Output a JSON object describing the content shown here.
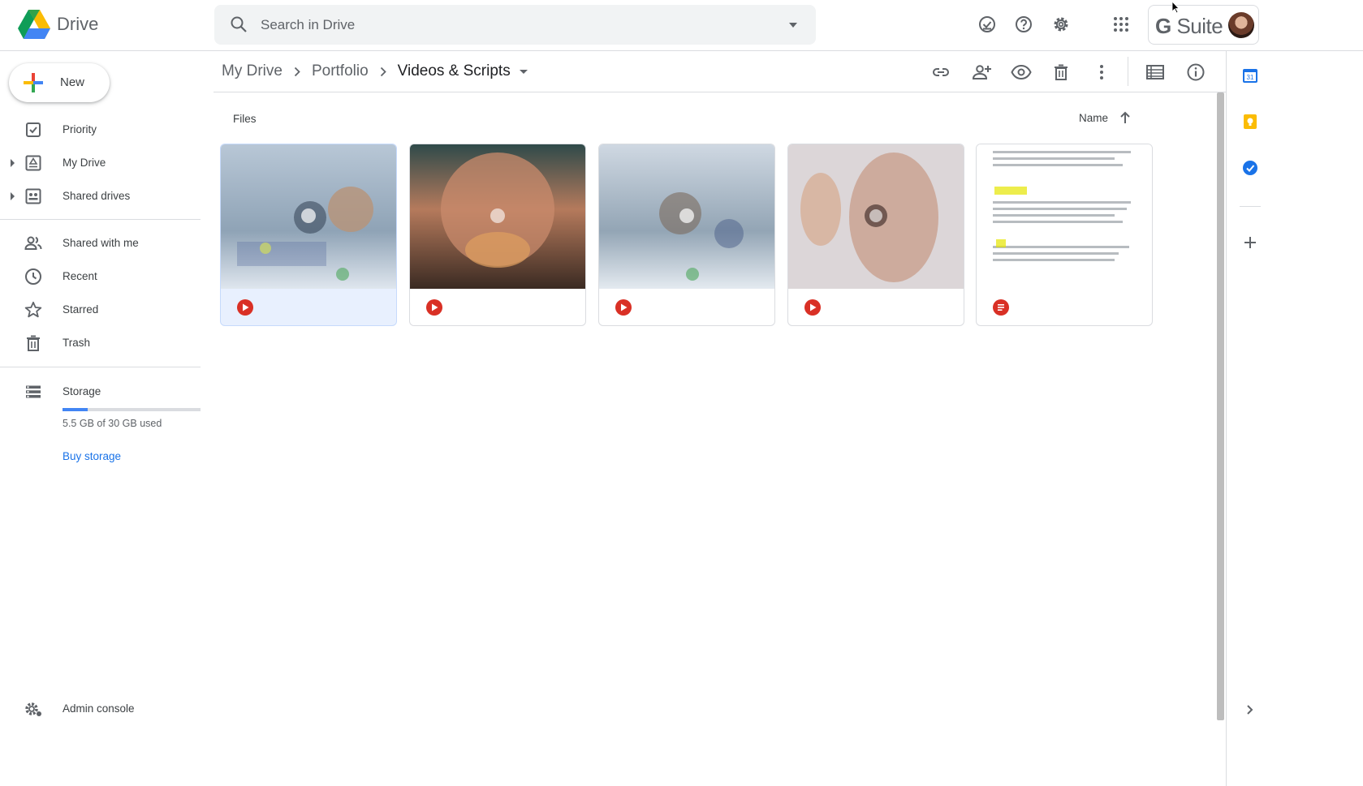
{
  "app": {
    "name": "Drive"
  },
  "search": {
    "placeholder": "Search in Drive"
  },
  "header_icons": [
    "ready-for-offline-icon",
    "help-icon",
    "settings-icon",
    "apps-grid-icon"
  ],
  "brand": {
    "suite_g": "G",
    "suite_text": "Suite"
  },
  "sidebar": {
    "new_label": "New",
    "items": [
      {
        "label": "Priority",
        "icon": "priority-icon"
      },
      {
        "label": "My Drive",
        "icon": "my-drive-icon"
      },
      {
        "label": "Shared drives",
        "icon": "shared-drives-icon"
      },
      {
        "label": "Shared with me",
        "icon": "shared-with-me-icon"
      },
      {
        "label": "Recent",
        "icon": "recent-icon"
      },
      {
        "label": "Starred",
        "icon": "star-icon"
      },
      {
        "label": "Trash",
        "icon": "trash-icon"
      }
    ],
    "storage": {
      "label": "Storage",
      "used_text": "5.5 GB of 30 GB used",
      "used_fraction": 0.183,
      "buy_label": "Buy storage"
    },
    "admin_label": "Admin console"
  },
  "breadcrumb": [
    "My Drive",
    "Portfolio",
    "Videos & Scripts"
  ],
  "toolbar_icons": [
    "get-link-icon",
    "share-icon",
    "preview-icon",
    "delete-icon",
    "more-icon",
    "list-view-icon",
    "info-icon"
  ],
  "files": {
    "section_title": "Files",
    "sort_label": "Name",
    "sort_direction": "ascending",
    "items": [
      {
        "name": "",
        "type": "video",
        "selected": true
      },
      {
        "name": "",
        "type": "video",
        "selected": false
      },
      {
        "name": "",
        "type": "video",
        "selected": false
      },
      {
        "name": "",
        "type": "video",
        "selected": false
      },
      {
        "name": "",
        "type": "document",
        "selected": false
      }
    ]
  },
  "right_rail_icons": [
    "calendar-icon",
    "keep-icon",
    "tasks-icon",
    "add-addon-icon",
    "expand-panel-icon"
  ],
  "colors": {
    "accent": "#1a73e8",
    "storage_fill": "#4285f4",
    "file_icon": "#d93025",
    "selected_bg": "#e8f0fe"
  }
}
